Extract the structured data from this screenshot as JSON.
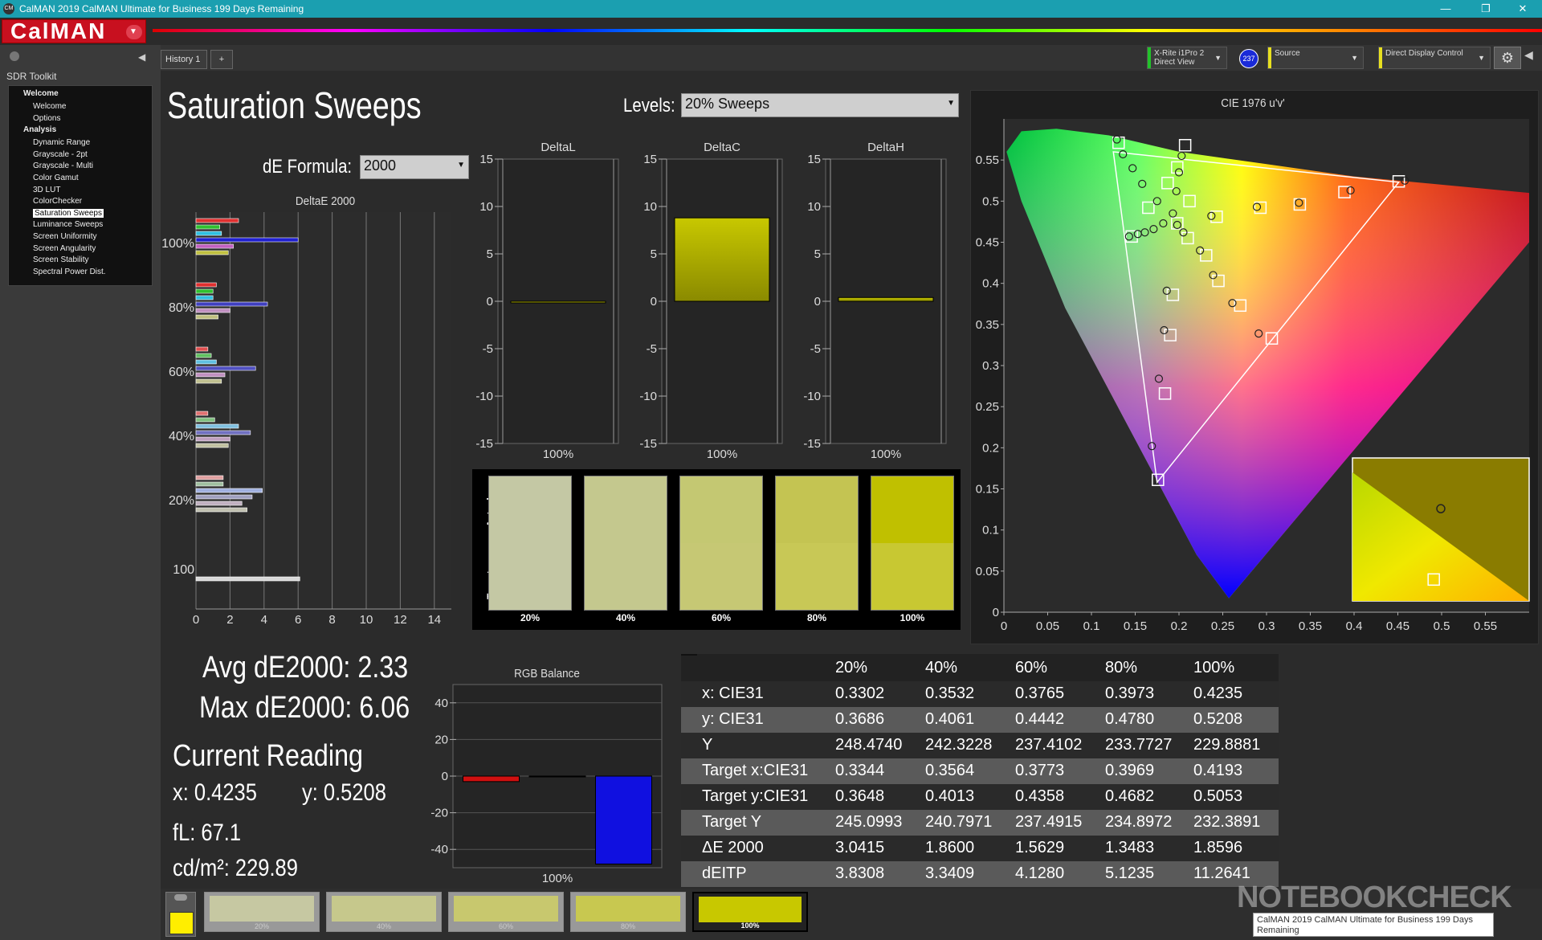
{
  "window": {
    "title": "CalMAN 2019 CalMAN Ultimate for Business 199 Days Remaining",
    "app_badge": "CM",
    "minimize": "—",
    "restore": "❐",
    "close": "✕"
  },
  "brand": {
    "logo": "CalMAN",
    "menu_icon": "chevron-down-icon",
    "brand_color": "#c8101f"
  },
  "sidebar": {
    "title": "SDR Toolkit",
    "items": [
      {
        "label": "Welcome",
        "type": "group"
      },
      {
        "label": "Welcome",
        "type": "item"
      },
      {
        "label": "Options",
        "type": "item"
      },
      {
        "label": "Analysis",
        "type": "group"
      },
      {
        "label": "Dynamic Range",
        "type": "item"
      },
      {
        "label": "Grayscale - 2pt",
        "type": "item"
      },
      {
        "label": "Grayscale - Multi",
        "type": "item"
      },
      {
        "label": "Color Gamut",
        "type": "item"
      },
      {
        "label": "3D LUT",
        "type": "item"
      },
      {
        "label": "ColorChecker",
        "type": "item"
      },
      {
        "label": "Saturation Sweeps",
        "type": "item",
        "selected": true
      },
      {
        "label": "Luminance Sweeps",
        "type": "item"
      },
      {
        "label": "Screen Uniformity",
        "type": "item"
      },
      {
        "label": "Screen Angularity",
        "type": "item"
      },
      {
        "label": "Screen Stability",
        "type": "item"
      },
      {
        "label": "Spectral Power Dist.",
        "type": "item"
      }
    ]
  },
  "tabs": {
    "history": "History 1",
    "add": "+"
  },
  "devices": {
    "meter_line1": "X-Rite i1Pro 2",
    "meter_line2": "Direct View",
    "meter_badge": "237",
    "source": "Source",
    "display": "Direct Display Control",
    "meter_color": "#22c22a",
    "source_color": "#e8e020"
  },
  "page": {
    "title": "Saturation Sweeps",
    "levels_label": "Levels:",
    "levels_value": "20% Sweeps",
    "formula_label": "dE Formula:",
    "formula_value": "2000"
  },
  "deltae": {
    "title": "DeltaE 2000",
    "x_ticks": [
      "0",
      "2",
      "4",
      "6",
      "8",
      "10",
      "12",
      "14"
    ],
    "y_labels": [
      "100%",
      "80%",
      "60%",
      "40%",
      "20%",
      "100"
    ],
    "xmax": 15,
    "groups": [
      {
        "bars": [
          {
            "v": 2.5,
            "c": "#e03030"
          },
          {
            "v": 1.4,
            "c": "#30c030"
          },
          {
            "v": 1.5,
            "c": "#30c0e0"
          },
          {
            "v": 6.0,
            "c": "#2020d0"
          },
          {
            "v": 2.2,
            "c": "#c060c0"
          },
          {
            "v": 1.9,
            "c": "#c0c040"
          }
        ]
      },
      {
        "bars": [
          {
            "v": 1.2,
            "c": "#e03030"
          },
          {
            "v": 1.0,
            "c": "#30c030"
          },
          {
            "v": 1.0,
            "c": "#30c0e0"
          },
          {
            "v": 4.2,
            "c": "#4040c0"
          },
          {
            "v": 2.0,
            "c": "#c090c0"
          },
          {
            "v": 1.3,
            "c": "#c0c080"
          }
        ]
      },
      {
        "bars": [
          {
            "v": 0.7,
            "c": "#e05050"
          },
          {
            "v": 0.9,
            "c": "#60c060"
          },
          {
            "v": 1.2,
            "c": "#60c0e0"
          },
          {
            "v": 3.5,
            "c": "#5050c0"
          },
          {
            "v": 1.7,
            "c": "#c090c0"
          },
          {
            "v": 1.5,
            "c": "#c0c090"
          }
        ]
      },
      {
        "bars": [
          {
            "v": 0.7,
            "c": "#e07070"
          },
          {
            "v": 1.1,
            "c": "#80c080"
          },
          {
            "v": 2.5,
            "c": "#80c0e0"
          },
          {
            "v": 3.2,
            "c": "#7070c0"
          },
          {
            "v": 2.0,
            "c": "#c0a0c0"
          },
          {
            "v": 1.9,
            "c": "#c0c0a0"
          }
        ]
      },
      {
        "bars": [
          {
            "v": 1.6,
            "c": "#e0a0a0"
          },
          {
            "v": 1.6,
            "c": "#a0c0a0"
          },
          {
            "v": 3.9,
            "c": "#a0b0e0"
          },
          {
            "v": 3.3,
            "c": "#a0a0c0"
          },
          {
            "v": 2.7,
            "c": "#c0b0c0"
          },
          {
            "v": 3.0,
            "c": "#c0c0b0"
          }
        ]
      },
      {
        "bars": [
          {
            "v": 6.1,
            "c": "#d8d8d8"
          }
        ]
      }
    ]
  },
  "delta_charts": [
    {
      "title": "DeltaL",
      "value": -0.1,
      "label": "100%"
    },
    {
      "title": "DeltaC",
      "value": 8.8,
      "label": "100%"
    },
    {
      "title": "DeltaH",
      "value": 0.4,
      "label": "100%"
    }
  ],
  "delta_axis": {
    "ticks": [
      "15",
      "10",
      "5",
      "0",
      "-5",
      "-10",
      "-15"
    ],
    "min": -15,
    "max": 15
  },
  "swatches": {
    "actual_label": "Actual",
    "target_label": "Target",
    "items": [
      {
        "label": "20%",
        "actual": "#c4c8a4",
        "target": "#c4c8a4"
      },
      {
        "label": "40%",
        "actual": "#c4c88e",
        "target": "#c4c88e"
      },
      {
        "label": "60%",
        "actual": "#c4c872",
        "target": "#c6c874"
      },
      {
        "label": "80%",
        "actual": "#c4c452",
        "target": "#c8c856"
      },
      {
        "label": "100%",
        "actual": "#c0c000",
        "target": "#c8c832"
      }
    ]
  },
  "stats": {
    "avg": "Avg dE2000: 2.33",
    "max": "Max dE2000: 6.06",
    "current_title": "Current Reading",
    "x": "x: 0.4235",
    "y": "y: 0.5208",
    "fl": "fL: 67.1",
    "cdm": "cd/m²: 229.89"
  },
  "rgb_balance": {
    "title": "RGB Balance",
    "ticks": [
      "40",
      "20",
      "0",
      "-20",
      "-40"
    ],
    "min": -50,
    "max": 50,
    "bars": [
      {
        "channel": "red",
        "v": -3,
        "c": "#d01010"
      },
      {
        "channel": "green",
        "v": 0,
        "c": "#10c010"
      },
      {
        "channel": "blue",
        "v": -48,
        "c": "#1010e0"
      }
    ],
    "label": "100%"
  },
  "table": {
    "columns": [
      "20%",
      "40%",
      "60%",
      "80%",
      "100%"
    ],
    "rows": [
      {
        "label": "x: CIE31",
        "values": [
          "0.3302",
          "0.3532",
          "0.3765",
          "0.3973",
          "0.4235"
        ]
      },
      {
        "label": "y: CIE31",
        "values": [
          "0.3686",
          "0.4061",
          "0.4442",
          "0.4780",
          "0.5208"
        ]
      },
      {
        "label": "Y",
        "values": [
          "248.4740",
          "242.3228",
          "237.4102",
          "233.7727",
          "229.8881"
        ]
      },
      {
        "label": "Target x:CIE31",
        "values": [
          "0.3344",
          "0.3564",
          "0.3773",
          "0.3969",
          "0.4193"
        ]
      },
      {
        "label": "Target y:CIE31",
        "values": [
          "0.3648",
          "0.4013",
          "0.4358",
          "0.4682",
          "0.5053"
        ]
      },
      {
        "label": "Target Y",
        "values": [
          "245.0993",
          "240.7971",
          "237.4915",
          "234.8972",
          "232.3891"
        ]
      },
      {
        "label": "ΔE 2000",
        "values": [
          "3.0415",
          "1.8600",
          "1.5629",
          "1.3483",
          "1.8596"
        ]
      },
      {
        "label": "dEITP",
        "values": [
          "3.8308",
          "3.3409",
          "4.1280",
          "5.1235",
          "11.2641"
        ]
      }
    ]
  },
  "cie": {
    "title": "CIE 1976 u'v'",
    "x_ticks": [
      "0",
      "0.05",
      "0.1",
      "0.15",
      "0.2",
      "0.25",
      "0.3",
      "0.35",
      "0.4",
      "0.45",
      "0.5",
      "0.55"
    ],
    "y_ticks": [
      "0",
      "0.05",
      "0.1",
      "0.15",
      "0.2",
      "0.25",
      "0.3",
      "0.35",
      "0.4",
      "0.45",
      "0.5",
      "0.55"
    ],
    "umax": 0.6,
    "vmax": 0.6,
    "targets": [
      [
        0.198,
        0.473
      ],
      [
        0.207,
        0.568
      ],
      [
        0.198,
        0.541
      ],
      [
        0.187,
        0.522
      ],
      [
        0.165,
        0.492
      ],
      [
        0.146,
        0.457
      ],
      [
        0.131,
        0.571
      ],
      [
        0.212,
        0.5
      ],
      [
        0.243,
        0.481
      ],
      [
        0.293,
        0.492
      ],
      [
        0.338,
        0.496
      ],
      [
        0.389,
        0.511
      ],
      [
        0.451,
        0.524
      ],
      [
        0.21,
        0.455
      ],
      [
        0.231,
        0.434
      ],
      [
        0.245,
        0.403
      ],
      [
        0.27,
        0.373
      ],
      [
        0.306,
        0.333
      ],
      [
        0.193,
        0.386
      ],
      [
        0.19,
        0.337
      ],
      [
        0.184,
        0.266
      ],
      [
        0.176,
        0.161
      ]
    ],
    "measured": [
      [
        0.198,
        0.471
      ],
      [
        0.203,
        0.555
      ],
      [
        0.2,
        0.535
      ],
      [
        0.197,
        0.512
      ],
      [
        0.193,
        0.485
      ],
      [
        0.182,
        0.473
      ],
      [
        0.171,
        0.466
      ],
      [
        0.161,
        0.462
      ],
      [
        0.153,
        0.46
      ],
      [
        0.143,
        0.457
      ],
      [
        0.129,
        0.575
      ],
      [
        0.136,
        0.557
      ],
      [
        0.147,
        0.54
      ],
      [
        0.158,
        0.521
      ],
      [
        0.175,
        0.5
      ],
      [
        0.237,
        0.482
      ],
      [
        0.289,
        0.493
      ],
      [
        0.337,
        0.498
      ],
      [
        0.396,
        0.513
      ],
      [
        0.458,
        0.525
      ],
      [
        0.205,
        0.462
      ],
      [
        0.224,
        0.44
      ],
      [
        0.239,
        0.41
      ],
      [
        0.261,
        0.376
      ],
      [
        0.291,
        0.339
      ],
      [
        0.186,
        0.391
      ],
      [
        0.183,
        0.343
      ],
      [
        0.177,
        0.284
      ],
      [
        0.169,
        0.202
      ]
    ],
    "inset": {
      "target": [
        0.46,
        0.85
      ],
      "measured": [
        0.5,
        0.78
      ]
    }
  },
  "footer": {
    "swatches": [
      {
        "label": "20%",
        "color": "#c6c8a2"
      },
      {
        "label": "40%",
        "color": "#c6c88c"
      },
      {
        "label": "60%",
        "color": "#c8c86e"
      },
      {
        "label": "80%",
        "color": "#c8c850"
      },
      {
        "label": "100%",
        "color": "#c8c800"
      }
    ],
    "current_color": "#ffee00"
  },
  "tooltip": "CalMAN 2019 CalMAN Ultimate for Business 199 Days Remaining",
  "watermark": "NOTEBOOKCHECK"
}
